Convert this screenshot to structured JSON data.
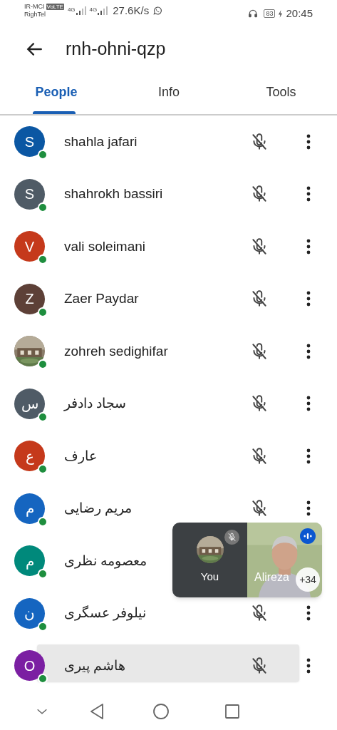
{
  "status_bar": {
    "carrier_1": "IR-MCI",
    "volte": "VoLTE",
    "carrier_2": "RighTel",
    "net_1": "4G",
    "net_2": "4G",
    "speed": "27.6K/s",
    "battery": "83",
    "time": "20:45"
  },
  "header": {
    "title": "rnh-ohni-qzp"
  },
  "tabs": [
    {
      "label": "People",
      "selected": true
    },
    {
      "label": "Info",
      "selected": false
    },
    {
      "label": "Tools",
      "selected": false
    }
  ],
  "participants": [
    {
      "name": "shahla jafari",
      "initial": "S",
      "color": "#0b57a3"
    },
    {
      "name": "shahrokh bassiri",
      "initial": "S",
      "color": "#4f5b66"
    },
    {
      "name": "vali soleimani",
      "initial": "V",
      "color": "#c5391b"
    },
    {
      "name": "Zaer Paydar",
      "initial": "Z",
      "color": "#5d4037"
    },
    {
      "name": "zohreh sedighifar",
      "kind": "picture"
    },
    {
      "name": "سجاد دادفر",
      "initial": "س",
      "color": "#4f5b66"
    },
    {
      "name": "عارف",
      "initial": "ع",
      "color": "#c5391b"
    },
    {
      "name": "مریم رضایی",
      "initial": "م",
      "color": "#1565c0"
    },
    {
      "name": "معصومه نظری",
      "initial": "م",
      "color": "#00897b",
      "kind": "covered"
    },
    {
      "name": "نیلوفر عسگری",
      "initial": "ن",
      "color": "#1565c0"
    },
    {
      "name": "هاشم پیری",
      "initial": "O",
      "color": "#7b1fa2",
      "toast": true
    }
  ],
  "call_panel": {
    "self_label": "You",
    "self_muted": true,
    "speaker_name": "Alireza",
    "speaking": true,
    "others_count": "+34"
  }
}
